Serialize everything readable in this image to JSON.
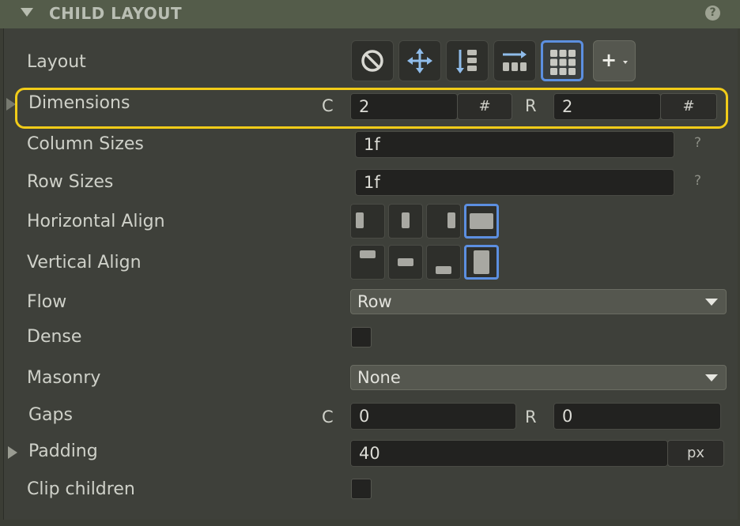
{
  "header": {
    "title": "CHILD LAYOUT",
    "help_icon": "?"
  },
  "rows": {
    "layout": {
      "label": "Layout",
      "add_label": "+",
      "options": [
        "none-icon",
        "move-icon",
        "stack-vertical-icon",
        "stack-horizontal-icon",
        "grid-icon"
      ],
      "selected": "grid-icon"
    },
    "dimensions": {
      "label": "Dimensions",
      "c_label": "C",
      "c_value": "2",
      "c_unit": "#",
      "r_label": "R",
      "r_value": "2",
      "r_unit": "#"
    },
    "column_sizes": {
      "label": "Column Sizes",
      "value": "1f",
      "help": "?"
    },
    "row_sizes": {
      "label": "Row Sizes",
      "value": "1f",
      "help": "?"
    },
    "horizontal_align": {
      "label": "Horizontal Align",
      "selected_index": 3
    },
    "vertical_align": {
      "label": "Vertical Align",
      "selected_index": 3
    },
    "flow": {
      "label": "Flow",
      "value": "Row"
    },
    "dense": {
      "label": "Dense",
      "checked": false
    },
    "masonry": {
      "label": "Masonry",
      "value": "None"
    },
    "gaps": {
      "label": "Gaps",
      "c_label": "C",
      "c_value": "0",
      "r_label": "R",
      "r_value": "0"
    },
    "padding": {
      "label": "Padding",
      "value": "40",
      "unit": "px"
    },
    "clip_children": {
      "label": "Clip children",
      "checked": false
    }
  },
  "colors": {
    "accent": "#5c8fe0",
    "highlight": "#f1cc19",
    "header_bg": "#545c4a"
  }
}
